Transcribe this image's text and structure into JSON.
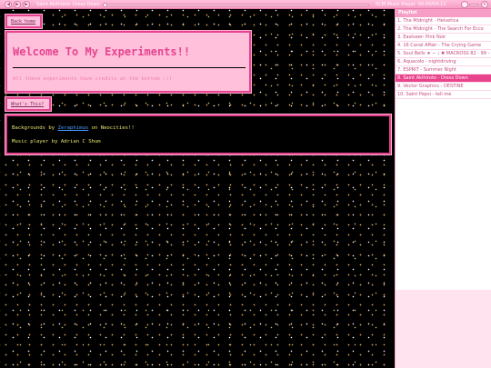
{
  "player": {
    "now_playing_artist": "Saint Akihiroto",
    "now_playing_separator": "-",
    "now_playing_title": "Dress Down",
    "progress_fraction": 0.004,
    "app_name": "SCM Music Player",
    "time": "00:00/04:11",
    "icons": {
      "prev": "previous-icon",
      "play": "play-icon",
      "next": "next-icon",
      "volume": "volume-icon",
      "close": "close-icon"
    },
    "icon_glyphs": {
      "prev": "◀",
      "play": "▶",
      "next": "▶",
      "close": "×"
    },
    "colors": {
      "bar": "#f79ec6",
      "highlight": "#e8448d"
    }
  },
  "playlist": {
    "header": "Playlist",
    "active_index": 7,
    "items": [
      "1. The Midnight - Helvetica",
      "2. The Midnight - The Search For Ecco",
      "3. Eastseer- Pink Noir",
      "4. 16 Canal Affair - The Crying Game",
      "5. Soul Bells ★ ∽ ♩ ✖ MACROSS 82 - 99 - Soul Bells",
      "6. Aquacolo - nightdriving",
      "7. ESPRIT - Summer Night",
      "8. Saint Akihiroto - Dress Down",
      "9. Vector Graphics - DESTINE",
      "10. Saint Pepsi - tell me"
    ]
  },
  "page": {
    "back_link": "Back home",
    "welcome_title": "Welcome To My Experiments!!",
    "welcome_subtitle": "All these experiments have credits at the bottom :))",
    "what_link": "What's This?",
    "credits_prefix": "Backgrounds by",
    "credits_link": "Zeraphimus",
    "credits_suffix": "on Neocities!!",
    "music_credit": "Music player by Adrian C Shum",
    "colors": {
      "accent": "#e6448f",
      "box": "#ffc0dc",
      "credit_text": "#e6e36a",
      "link": "#4a9cff"
    }
  }
}
